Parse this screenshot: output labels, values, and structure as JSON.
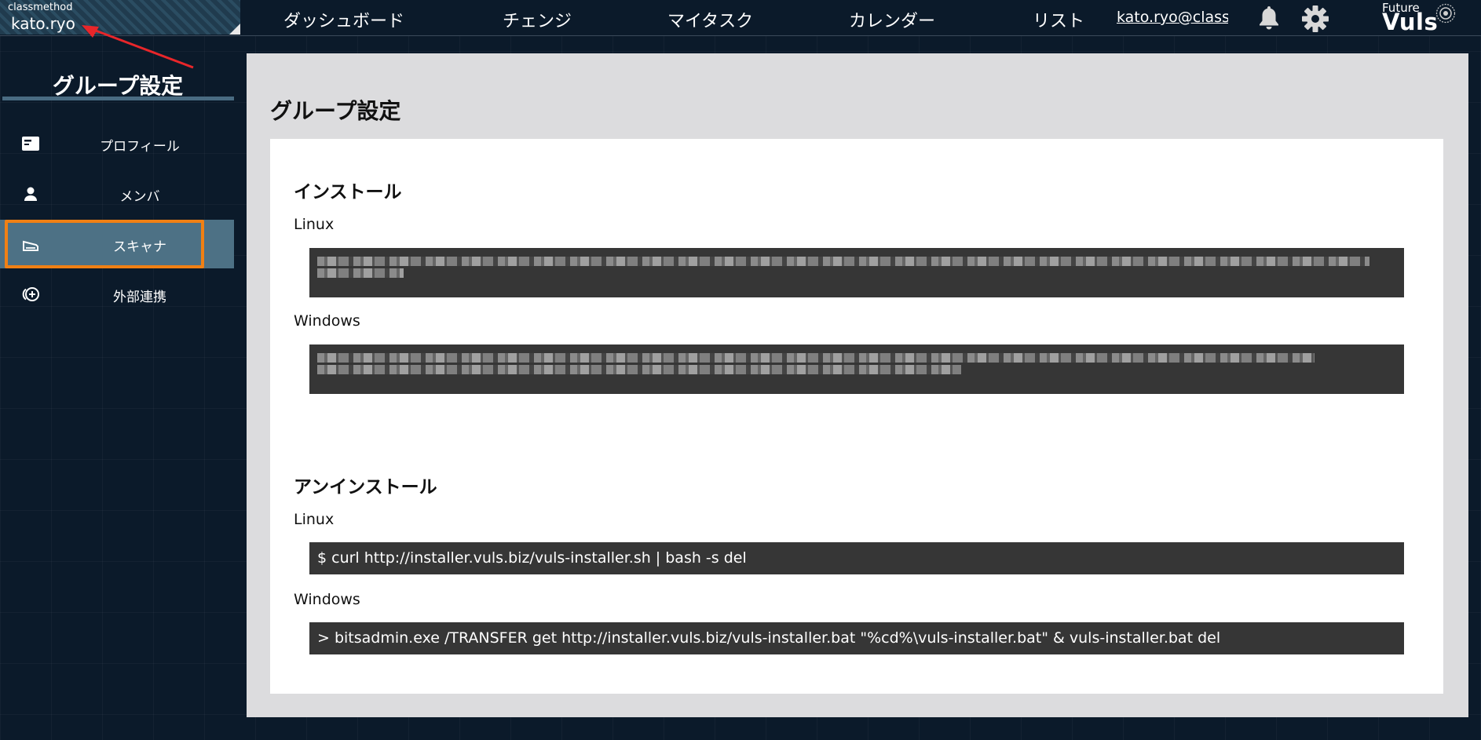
{
  "header": {
    "org": "classmethod",
    "user": "kato.ryo",
    "nav": [
      "ダッシュボード",
      "チェンジ",
      "マイタスク",
      "カレンダー",
      "リスト"
    ],
    "email": "kato.ryo@classi",
    "notification_icon": "bell-icon",
    "settings_icon": "gear-icon",
    "brand": {
      "line1": "Future",
      "line2": "Vuls"
    }
  },
  "sidebar": {
    "title": "グループ設定",
    "items": [
      {
        "label": "プロフィール",
        "icon": "profile-card-icon",
        "active": false
      },
      {
        "label": "メンバ",
        "icon": "person-icon",
        "active": false
      },
      {
        "label": "スキャナ",
        "icon": "scanner-icon",
        "active": true
      },
      {
        "label": "外部連携",
        "icon": "integration-icon",
        "active": false
      }
    ]
  },
  "main": {
    "title": "グループ設定",
    "install": {
      "title": "インストール",
      "linux_label": "Linux",
      "windows_label": "Windows"
    },
    "uninstall": {
      "title": "アンインストール",
      "linux_label": "Linux",
      "linux_cmd": "$ curl http://installer.vuls.biz/vuls-installer.sh | bash -s del",
      "windows_label": "Windows",
      "windows_cmd": "> bitsadmin.exe /TRANSFER get http://installer.vuls.biz/vuls-installer.bat \"%cd%\\vuls-installer.bat\" & vuls-installer.bat del"
    }
  },
  "colors": {
    "background": "#0b1a2a",
    "active_item": "#4d7185",
    "highlight_outline": "#f08014",
    "annotation_arrow": "#e8262a",
    "code_background": "#363636",
    "panel": "#dcdcde"
  }
}
